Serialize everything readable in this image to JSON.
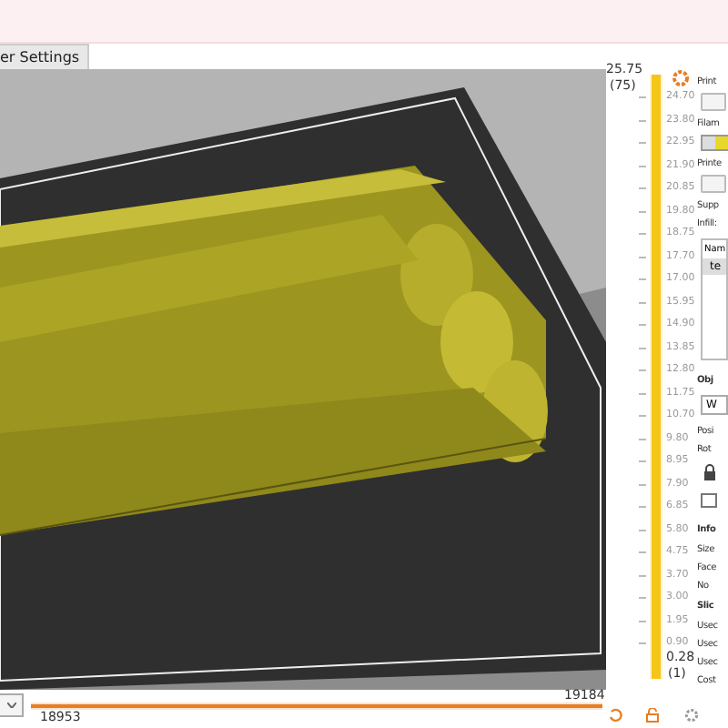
{
  "tab": {
    "label": "er Settings",
    "selected": true
  },
  "layer_slider": {
    "top_value": "25.75",
    "top_layer": "(75)",
    "bottom_value": "0.28",
    "bottom_layer": "(1)",
    "level": 1,
    "ticks": [
      "24.70",
      "23.80",
      "22.95",
      "21.90",
      "20.85",
      "19.80",
      "18.75",
      "17.70",
      "17.00",
      "15.95",
      "14.90",
      "13.85",
      "12.80",
      "11.75",
      "10.70",
      "9.80",
      "8.95",
      "7.90",
      "6.85",
      "5.80",
      "4.75",
      "3.70",
      "3.00",
      "1.95",
      "0.90"
    ]
  },
  "move_slider": {
    "start": "18953",
    "end": "19184",
    "level": 1
  },
  "sidebar": [
    {
      "kind": "label",
      "text": "Print"
    },
    {
      "kind": "preset"
    },
    {
      "kind": "label",
      "text": "Filam"
    },
    {
      "kind": "swatch"
    },
    {
      "kind": "label",
      "text": "Printe"
    },
    {
      "kind": "preset"
    },
    {
      "kind": "label",
      "text": "Supp"
    },
    {
      "kind": "label",
      "text": "Infill:"
    },
    {
      "kind": "table",
      "header": "Nam",
      "row": "te"
    },
    {
      "kind": "header",
      "text": "Obj"
    },
    {
      "kind": "field",
      "text": "W"
    },
    {
      "kind": "label",
      "text": "Posi"
    },
    {
      "kind": "label",
      "text": "Rot"
    },
    {
      "kind": "lock"
    },
    {
      "kind": "checkbox",
      "checked": false
    },
    {
      "kind": "header",
      "text": "Info"
    },
    {
      "kind": "label",
      "text": "Size"
    },
    {
      "kind": "label",
      "text": "Face"
    },
    {
      "kind": "label",
      "text": "No"
    },
    {
      "kind": "header",
      "text": "Slic"
    },
    {
      "kind": "label",
      "text": "Usec"
    },
    {
      "kind": "label",
      "text": "Usec"
    },
    {
      "kind": "label",
      "text": "Usec"
    },
    {
      "kind": "label",
      "text": "Cost"
    }
  ]
}
